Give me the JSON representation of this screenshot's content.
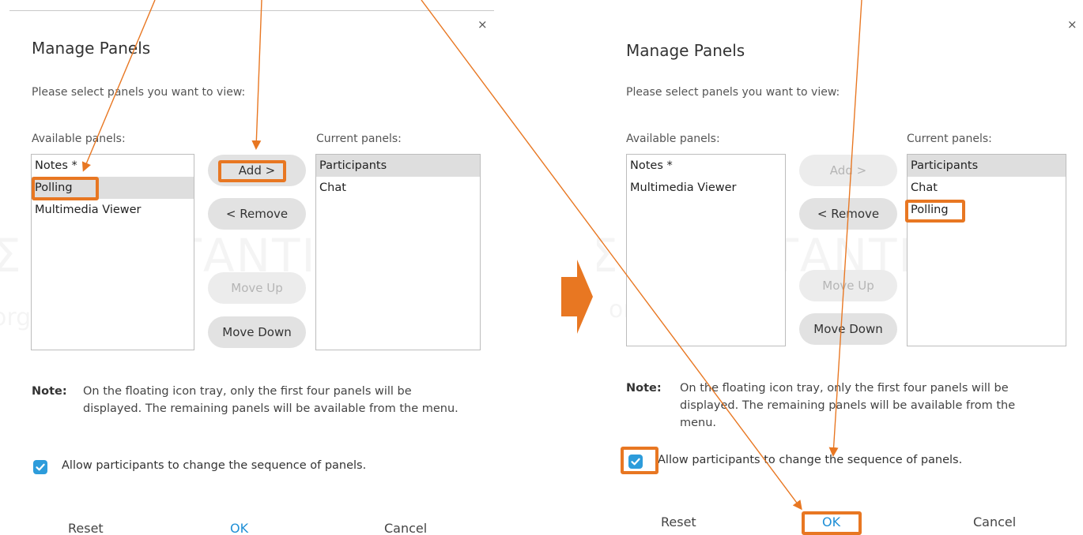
{
  "watermark": {
    "main": "Σ ΚΩΝΣΤΑΝΤΙΝΟΣ",
    "sub": "orgme"
  },
  "dialogs": [
    {
      "id": "before",
      "close_glyph": "×",
      "title": "Manage Panels",
      "subtitle": "Please select panels you want to view:",
      "available_label": "Available panels:",
      "current_label": "Current panels:",
      "available": [
        {
          "label": "Notes *",
          "selected": false
        },
        {
          "label": "Polling",
          "selected": true
        },
        {
          "label": "Multimedia Viewer",
          "selected": false
        }
      ],
      "current": [
        {
          "label": "Participants",
          "selected": true
        },
        {
          "label": "Chat",
          "selected": false
        }
      ],
      "buttons": {
        "add": "Add >",
        "remove": "< Remove",
        "move_up": "Move Up",
        "move_down": "Move Down"
      },
      "note_label": "Note:",
      "note_text": "On the floating icon tray, only the first four panels will be displayed. The remaining panels will be available from the menu.",
      "allow_label": "Allow participants to change the sequence of panels.",
      "allow_checked": true,
      "footer": {
        "reset": "Reset",
        "ok": "OK",
        "cancel": "Cancel"
      }
    },
    {
      "id": "after",
      "close_glyph": "×",
      "title": "Manage Panels",
      "subtitle": "Please select panels you want to view:",
      "available_label": "Available panels:",
      "current_label": "Current panels:",
      "available": [
        {
          "label": "Notes *",
          "selected": false
        },
        {
          "label": "Multimedia Viewer",
          "selected": false
        }
      ],
      "current": [
        {
          "label": "Participants",
          "selected": true
        },
        {
          "label": "Chat",
          "selected": false
        },
        {
          "label": "Polling",
          "selected": false
        }
      ],
      "buttons": {
        "add": "Add >",
        "remove": "< Remove",
        "move_up": "Move Up",
        "move_down": "Move Down"
      },
      "note_label": "Note:",
      "note_text": "On the floating icon tray, only the first four panels will be displayed. The remaining panels will be available from the menu.",
      "allow_label": "Allow participants to change the sequence of panels.",
      "allow_checked": true,
      "footer": {
        "reset": "Reset",
        "ok": "OK",
        "cancel": "Cancel"
      }
    }
  ],
  "colors": {
    "annotation": "#e87722",
    "ok_text": "#1f8fd6",
    "checkbox": "#2d9cdb"
  }
}
